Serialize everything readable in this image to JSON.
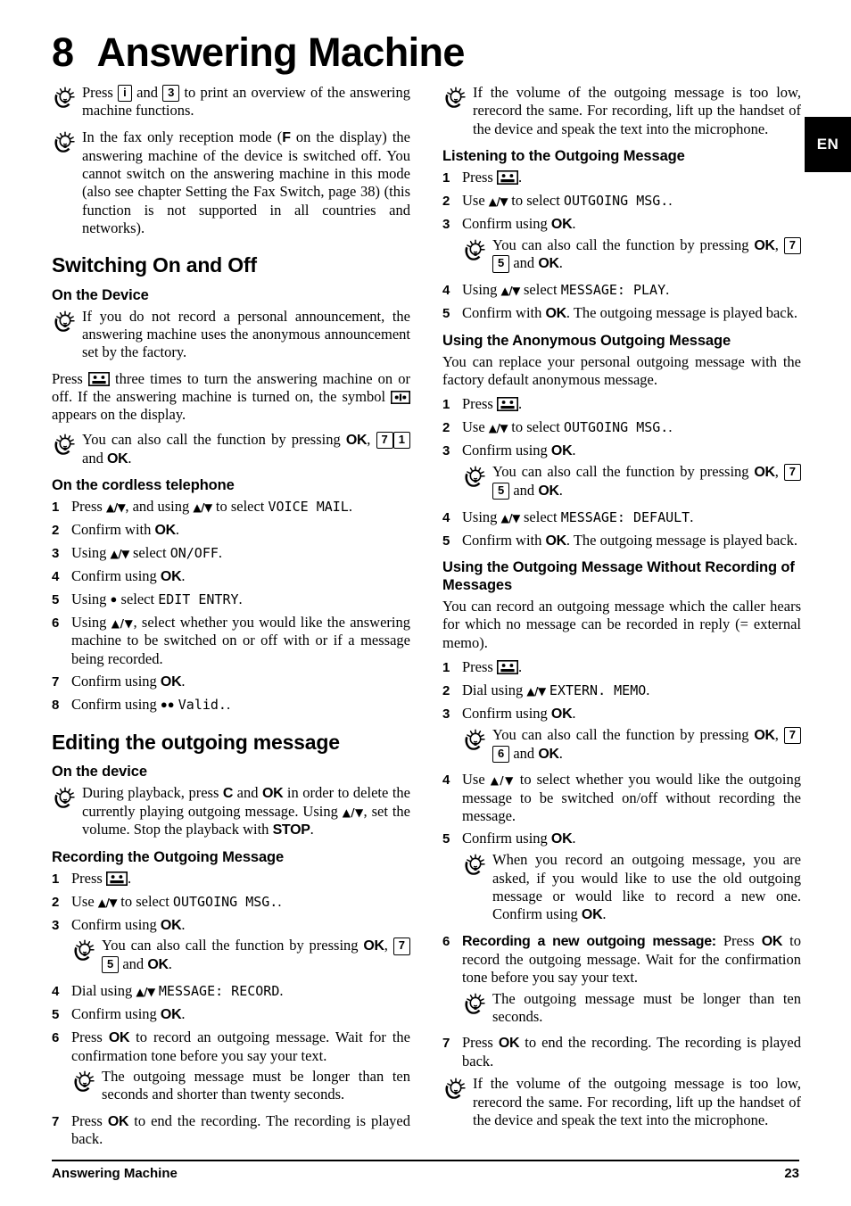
{
  "chapter": {
    "number": "8",
    "title": "Answering Machine"
  },
  "language_tab": "EN",
  "footer": {
    "left": "Answering Machine",
    "page_number": "23"
  },
  "icons": {
    "tip": "lightbulb-tip-icon",
    "answering_machine_key": "answering-machine-key-icon",
    "display_symbol": "answering-machine-display-symbol"
  },
  "left_column": {
    "tip_print_overview": {
      "pre": "Press ",
      "key1": "i",
      "mid": " and ",
      "key2": "3",
      "post": " to print an overview of the answering machine functions."
    },
    "tip_fax_only": {
      "p1": "In the fax only reception mode (",
      "bold_f": "F",
      "p2": " on the display) the answering machine of the device is switched off. You cannot switch on the answering machine in this mode (also see chapter Setting the Fax Switch, page 38) (this function is not supported in all countries and networks)."
    },
    "heading_switching": "Switching On and Off",
    "heading_on_device": "On the Device",
    "tip_anonymous_announcement": "If you do not record a personal announcement, the answering machine uses the anonymous announcement set by the factory.",
    "press_three_times": {
      "pre": "Press ",
      "mid": " three times to turn the answering machine on or off. If the answering machine is turned on, the symbol ",
      "post": " appears on the display."
    },
    "tip_call_71": {
      "pre": "You can also call the function by pressing ",
      "ok1": "OK",
      "comma": ", ",
      "key1": "7",
      "key2": "1",
      "mid": " and ",
      "ok2": "OK",
      "post": "."
    },
    "heading_cordless": "On the cordless telephone",
    "cordless_steps": [
      {
        "num": "1",
        "parts": [
          {
            "t": "text",
            "v": "Press "
          },
          {
            "t": "arrows",
            "v": "▲/▼"
          },
          {
            "t": "text",
            "v": ", and using "
          },
          {
            "t": "arrows",
            "v": "▲/▼"
          },
          {
            "t": "text",
            "v": " to select "
          },
          {
            "t": "mono",
            "v": "VOICE MAIL"
          },
          {
            "t": "text",
            "v": "."
          }
        ]
      },
      {
        "num": "2",
        "parts": [
          {
            "t": "text",
            "v": "Confirm with "
          },
          {
            "t": "bold",
            "v": "OK"
          },
          {
            "t": "text",
            "v": "."
          }
        ]
      },
      {
        "num": "3",
        "parts": [
          {
            "t": "text",
            "v": "Using "
          },
          {
            "t": "arrows",
            "v": "▲/▼"
          },
          {
            "t": "text",
            "v": " select "
          },
          {
            "t": "mono",
            "v": "ON/OFF"
          },
          {
            "t": "text",
            "v": "."
          }
        ]
      },
      {
        "num": "4",
        "parts": [
          {
            "t": "text",
            "v": "Confirm using "
          },
          {
            "t": "bold",
            "v": "OK"
          },
          {
            "t": "text",
            "v": "."
          }
        ]
      },
      {
        "num": "5",
        "parts": [
          {
            "t": "text",
            "v": "Using "
          },
          {
            "t": "bullet",
            "v": "●"
          },
          {
            "t": "text",
            "v": " select "
          },
          {
            "t": "mono",
            "v": "EDIT ENTRY"
          },
          {
            "t": "text",
            "v": "."
          }
        ]
      },
      {
        "num": "6",
        "parts": [
          {
            "t": "text",
            "v": "Using "
          },
          {
            "t": "arrows",
            "v": "▲/▼"
          },
          {
            "t": "text",
            "v": ", select whether you would like the answering machine to be switched on or off with or if a message being recorded."
          }
        ]
      },
      {
        "num": "7",
        "parts": [
          {
            "t": "text",
            "v": "Confirm using "
          },
          {
            "t": "bold",
            "v": "OK"
          },
          {
            "t": "text",
            "v": "."
          }
        ]
      },
      {
        "num": "8",
        "parts": [
          {
            "t": "text",
            "v": "Confirm using "
          },
          {
            "t": "bullet",
            "v": "●●"
          },
          {
            "t": "text",
            "v": " "
          },
          {
            "t": "mono",
            "v": "Valid."
          },
          {
            "t": "text",
            "v": "."
          }
        ]
      }
    ],
    "heading_editing": "Editing the outgoing message",
    "heading_on_the_device": "On the device",
    "tip_during_playback": {
      "p1": "During playback, press ",
      "c": "C",
      "p2": " and ",
      "ok": "OK",
      "p3": " in order to delete the currently playing outgoing message. Using ",
      "arrows": "▲/▼",
      "p4": ", set the volume. Stop the playback with ",
      "stop": "STOP",
      "p5": "."
    },
    "heading_recording_om": "Recording the Outgoing Message",
    "recording_steps": [
      {
        "num": "1",
        "parts": [
          {
            "t": "text",
            "v": "Press "
          },
          {
            "t": "amkey",
            "v": ""
          },
          {
            "t": "text",
            "v": "."
          }
        ]
      },
      {
        "num": "2",
        "parts": [
          {
            "t": "text",
            "v": "Use "
          },
          {
            "t": "arrows",
            "v": "▲/▼"
          },
          {
            "t": "text",
            "v": " to select "
          },
          {
            "t": "mono",
            "v": "OUTGOING MSG."
          },
          {
            "t": "text",
            "v": "."
          }
        ]
      },
      {
        "num": "3",
        "parts": [
          {
            "t": "text",
            "v": "Confirm using "
          },
          {
            "t": "bold",
            "v": "OK"
          },
          {
            "t": "text",
            "v": "."
          }
        ],
        "tip": {
          "pre": "You can also call the function by pressing ",
          "ok1": "OK",
          "comma": ", ",
          "key1": "7",
          "key2": "5",
          "mid": " and ",
          "ok2": "OK",
          "post": "."
        }
      },
      {
        "num": "4",
        "parts": [
          {
            "t": "text",
            "v": "Dial using "
          },
          {
            "t": "arrows",
            "v": "▲/▼"
          },
          {
            "t": "text",
            "v": " "
          },
          {
            "t": "mono",
            "v": "MESSAGE: RECORD"
          },
          {
            "t": "text",
            "v": "."
          }
        ]
      },
      {
        "num": "5",
        "parts": [
          {
            "t": "text",
            "v": "Confirm using "
          },
          {
            "t": "bold",
            "v": "OK"
          },
          {
            "t": "text",
            "v": "."
          }
        ]
      },
      {
        "num": "6",
        "parts": [
          {
            "t": "text",
            "v": "Press "
          },
          {
            "t": "bold",
            "v": "OK"
          },
          {
            "t": "text",
            "v": " to record an outgoing message. Wait for the confirmation tone before you say your text."
          }
        ],
        "tip_plain": "The outgoing message must be longer than ten seconds and shorter than twenty seconds."
      },
      {
        "num": "7",
        "parts": [
          {
            "t": "text",
            "v": "Press "
          },
          {
            "t": "bold",
            "v": "OK"
          },
          {
            "t": "text",
            "v": " to end the recording. The recording is played back."
          }
        ]
      }
    ]
  },
  "right_column": {
    "tip_volume_low_top": "If the volume of the outgoing message is too low, rerecord the same. For recording, lift up the handset of the device and speak the text into the microphone.",
    "heading_listening": "Listening to the Outgoing Message",
    "listening_steps": [
      {
        "num": "1",
        "parts": [
          {
            "t": "text",
            "v": "Press "
          },
          {
            "t": "amkey",
            "v": ""
          },
          {
            "t": "text",
            "v": "."
          }
        ]
      },
      {
        "num": "2",
        "parts": [
          {
            "t": "text",
            "v": "Use "
          },
          {
            "t": "arrows",
            "v": "▲/▼"
          },
          {
            "t": "text",
            "v": " to select "
          },
          {
            "t": "mono",
            "v": "OUTGOING MSG."
          },
          {
            "t": "text",
            "v": "."
          }
        ]
      },
      {
        "num": "3",
        "parts": [
          {
            "t": "text",
            "v": "Confirm using "
          },
          {
            "t": "bold",
            "v": "OK"
          },
          {
            "t": "text",
            "v": "."
          }
        ],
        "tip": {
          "pre": "You can also call the function by pressing ",
          "ok1": "OK",
          "comma": ", ",
          "key1": "7",
          "key2": "5",
          "mid": " and ",
          "ok2": "OK",
          "post": "."
        }
      },
      {
        "num": "4",
        "parts": [
          {
            "t": "text",
            "v": "Using "
          },
          {
            "t": "arrows",
            "v": "▲/▼"
          },
          {
            "t": "text",
            "v": " select "
          },
          {
            "t": "mono",
            "v": "MESSAGE: PLAY"
          },
          {
            "t": "text",
            "v": "."
          }
        ]
      },
      {
        "num": "5",
        "parts": [
          {
            "t": "text",
            "v": "Confirm with "
          },
          {
            "t": "bold",
            "v": "OK"
          },
          {
            "t": "text",
            "v": ". The outgoing message is played back."
          }
        ]
      }
    ],
    "heading_anonymous": "Using the Anonymous Outgoing Message",
    "anonymous_intro": "You can replace your personal outgoing message with the factory default anonymous message.",
    "anonymous_steps": [
      {
        "num": "1",
        "parts": [
          {
            "t": "text",
            "v": "Press "
          },
          {
            "t": "amkey",
            "v": ""
          },
          {
            "t": "text",
            "v": "."
          }
        ]
      },
      {
        "num": "2",
        "parts": [
          {
            "t": "text",
            "v": "Use "
          },
          {
            "t": "arrows",
            "v": "▲/▼"
          },
          {
            "t": "text",
            "v": " to select "
          },
          {
            "t": "mono",
            "v": "OUTGOING MSG."
          },
          {
            "t": "text",
            "v": "."
          }
        ]
      },
      {
        "num": "3",
        "parts": [
          {
            "t": "text",
            "v": "Confirm using "
          },
          {
            "t": "bold",
            "v": "OK"
          },
          {
            "t": "text",
            "v": "."
          }
        ],
        "tip": {
          "pre": "You can also call the function by pressing ",
          "ok1": "OK",
          "comma": ", ",
          "key1": "7",
          "key2": "5",
          "mid": " and ",
          "ok2": "OK",
          "post": "."
        }
      },
      {
        "num": "4",
        "parts": [
          {
            "t": "text",
            "v": "Using "
          },
          {
            "t": "arrows",
            "v": "▲/▼"
          },
          {
            "t": "text",
            "v": " select "
          },
          {
            "t": "mono",
            "v": "MESSAGE: DEFAULT"
          },
          {
            "t": "text",
            "v": "."
          }
        ]
      },
      {
        "num": "5",
        "parts": [
          {
            "t": "text",
            "v": "Confirm with "
          },
          {
            "t": "bold",
            "v": "OK"
          },
          {
            "t": "text",
            "v": ". The outgoing message is played back."
          }
        ]
      }
    ],
    "heading_without_recording": "Using the Outgoing Message Without Recording of Messages",
    "without_recording_intro": "You can record an outgoing message which the caller hears for which no message can be recorded in reply (= external memo).",
    "without_recording_steps": [
      {
        "num": "1",
        "parts": [
          {
            "t": "text",
            "v": "Press "
          },
          {
            "t": "amkey",
            "v": ""
          },
          {
            "t": "text",
            "v": "."
          }
        ]
      },
      {
        "num": "2",
        "parts": [
          {
            "t": "text",
            "v": "Dial using "
          },
          {
            "t": "arrows",
            "v": "▲/▼"
          },
          {
            "t": "text",
            "v": " "
          },
          {
            "t": "mono",
            "v": "EXTERN. MEMO"
          },
          {
            "t": "text",
            "v": "."
          }
        ]
      },
      {
        "num": "3",
        "parts": [
          {
            "t": "text",
            "v": "Confirm using "
          },
          {
            "t": "bold",
            "v": "OK"
          },
          {
            "t": "text",
            "v": "."
          }
        ],
        "tip": {
          "pre": "You can also call the function by pressing ",
          "ok1": "OK",
          "comma": ", ",
          "key1": "7",
          "key2": "6",
          "mid": " and ",
          "ok2": "OK",
          "post": "."
        }
      },
      {
        "num": "4",
        "parts": [
          {
            "t": "text",
            "v": "Use "
          },
          {
            "t": "arrows",
            "v": "▲/▼"
          },
          {
            "t": "text",
            "v": " to select whether you would like the outgoing message to be switched on/off without recording the message."
          }
        ]
      },
      {
        "num": "5",
        "parts": [
          {
            "t": "text",
            "v": "Confirm using "
          },
          {
            "t": "bold",
            "v": "OK"
          },
          {
            "t": "text",
            "v": "."
          }
        ],
        "tip_rich": {
          "p1": "When you record an outgoing message, you are asked, if you would like to use the old outgoing message or would like to record a new one. Confirm using ",
          "ok": "OK",
          "p2": "."
        }
      },
      {
        "num": "6",
        "parts": [
          {
            "t": "boldlead",
            "v": "Recording a new outgoing message:"
          },
          {
            "t": "text",
            "v": " Press "
          },
          {
            "t": "bold",
            "v": "OK"
          },
          {
            "t": "text",
            "v": " to record the outgoing message. Wait for the confirmation tone before you say your text."
          }
        ],
        "tip_plain": "The outgoing message must be longer than ten seconds."
      },
      {
        "num": "7",
        "parts": [
          {
            "t": "text",
            "v": "Press "
          },
          {
            "t": "bold",
            "v": "OK"
          },
          {
            "t": "text",
            "v": " to end the recording. The recording is played back."
          }
        ]
      }
    ],
    "tip_volume_low_bottom": "If the volume of the outgoing message is too low, rerecord the same. For recording, lift up the handset of the device and speak the text into the microphone."
  }
}
